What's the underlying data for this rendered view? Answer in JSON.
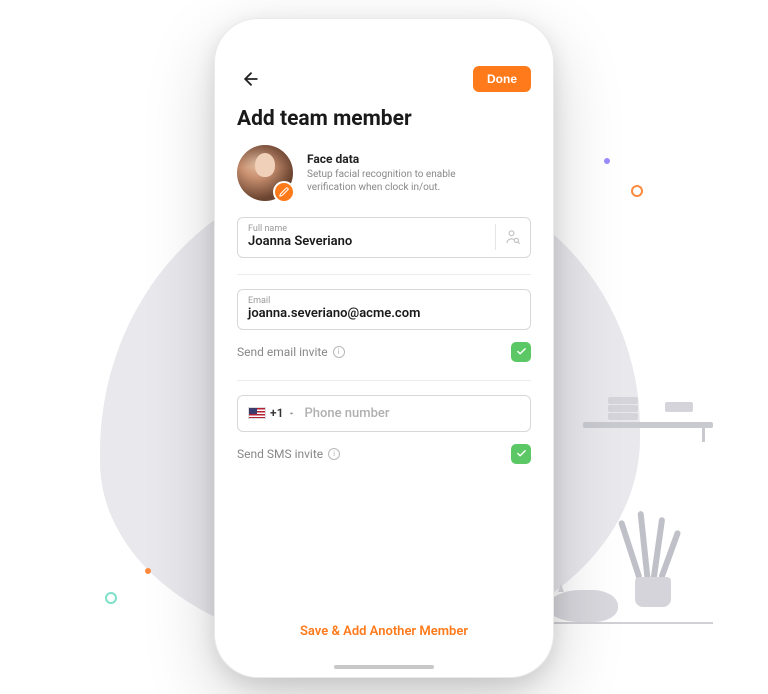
{
  "colors": {
    "accent": "#ff7a1a",
    "success": "#5cc865"
  },
  "header": {
    "done_label": "Done",
    "title": "Add team member"
  },
  "face_data": {
    "heading": "Face data",
    "description": "Setup facial recognition to enable verification when clock in/out."
  },
  "fields": {
    "full_name": {
      "label": "Full name",
      "value": "Joanna Severiano"
    },
    "email": {
      "label": "Email",
      "value": "joanna.severiano@acme.com"
    },
    "phone": {
      "country_code": "+1",
      "placeholder": "Phone number",
      "value": ""
    }
  },
  "invites": {
    "email_label": "Send email invite",
    "email_checked": true,
    "sms_label": "Send SMS invite",
    "sms_checked": true
  },
  "footer": {
    "save_another_label": "Save & Add Another Member"
  }
}
